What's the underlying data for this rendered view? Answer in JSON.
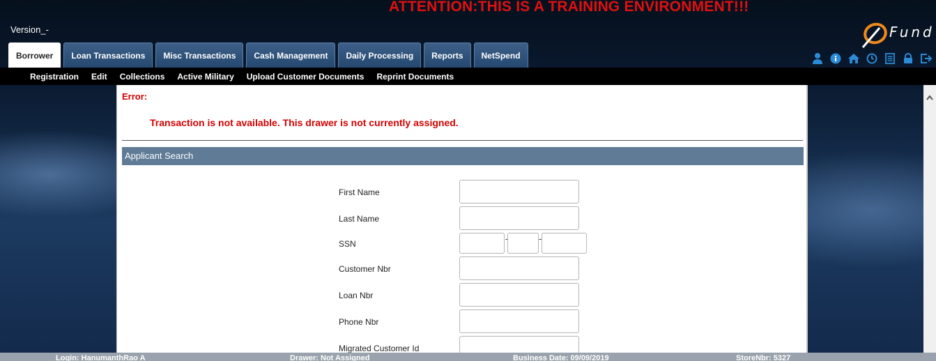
{
  "banner": {
    "attention": "ATTENTION:THIS IS A TRAINING ENVIRONMENT!!!"
  },
  "header": {
    "version": "Version_-",
    "logo_text": "Fund"
  },
  "tabs": [
    {
      "label": "Borrower",
      "active": true
    },
    {
      "label": "Loan Transactions"
    },
    {
      "label": "Misc Transactions"
    },
    {
      "label": "Cash Management"
    },
    {
      "label": "Daily Processing"
    },
    {
      "label": "Reports"
    },
    {
      "label": "NetSpend"
    }
  ],
  "header_icons": [
    "user-icon",
    "info-icon",
    "home-icon",
    "clock-icon",
    "document-icon",
    "lock-icon",
    "logout-icon"
  ],
  "subnav": [
    {
      "label": "Registration"
    },
    {
      "label": "Edit"
    },
    {
      "label": "Collections"
    },
    {
      "label": "Active Military"
    },
    {
      "label": "Upload Customer Documents"
    },
    {
      "label": "Reprint Documents"
    }
  ],
  "error": {
    "title": "Error:",
    "message": "Transaction is not available. This drawer is not currently assigned."
  },
  "section": {
    "title": "Applicant Search"
  },
  "form": {
    "first_name": "First Name",
    "last_name": "Last Name",
    "ssn": "SSN",
    "customer_nbr": "Customer Nbr",
    "loan_nbr": "Loan Nbr",
    "phone_nbr": "Phone Nbr",
    "migrated_customer_id": "Migrated Customer Id"
  },
  "status": {
    "login": "Login: HanumanthRao A",
    "drawer": "Drawer: Not Assigned",
    "business_date": "Business Date: 09/09/2019",
    "store": "StoreNbr: 5327"
  },
  "colors": {
    "attention": "#e01010",
    "error": "#d40000",
    "section_bar": "#5f7b96",
    "icon_blue": "#2b8bd6",
    "logo_orange": "#f08a1c"
  }
}
